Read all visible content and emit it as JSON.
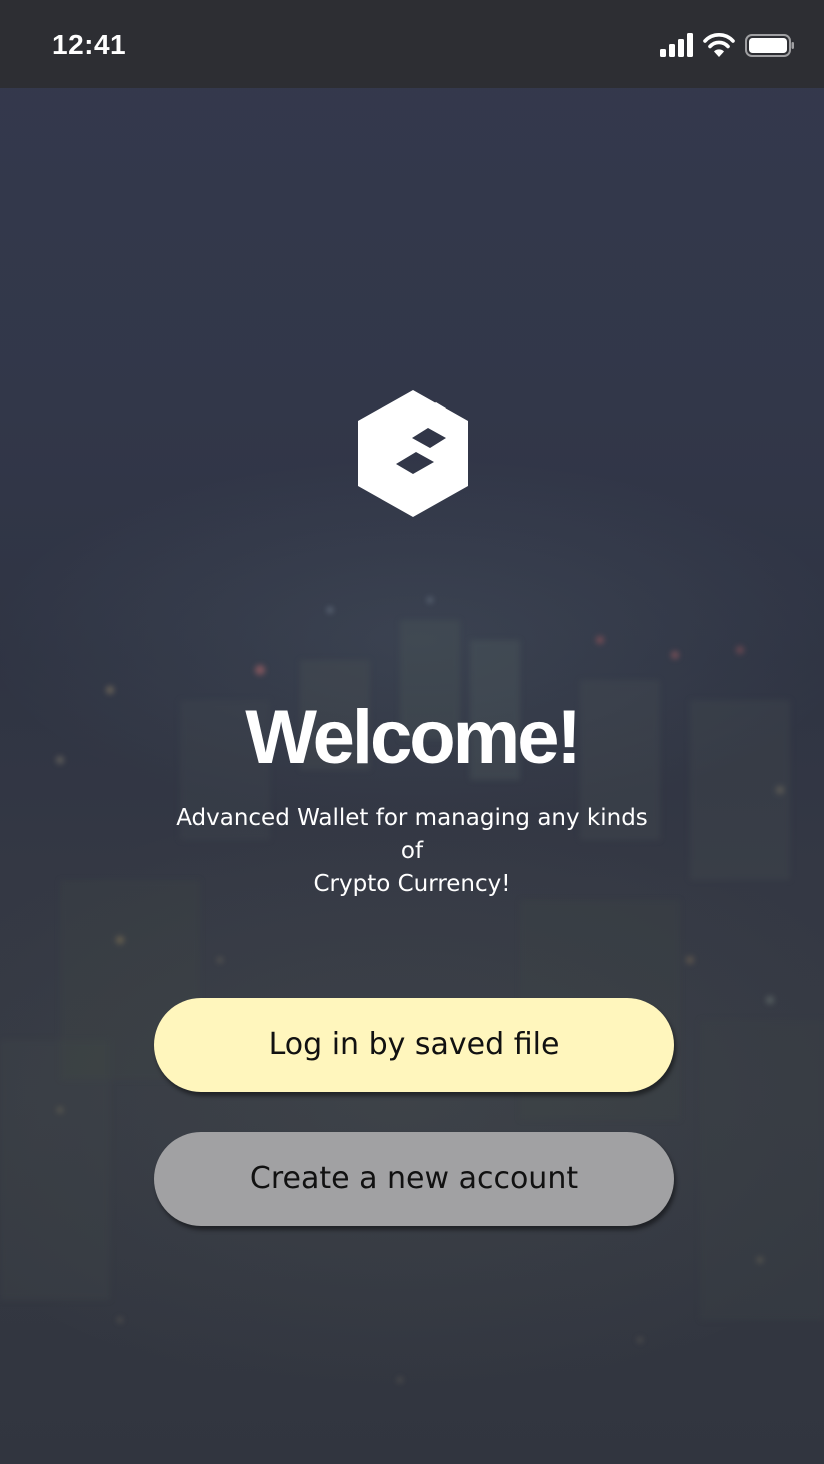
{
  "status_bar": {
    "time": "12:41",
    "icons": [
      "cellular-signal-icon",
      "wifi-icon",
      "battery-icon"
    ]
  },
  "logo": {
    "icon": "wallet-logo-icon"
  },
  "welcome": {
    "title": "Welcome!",
    "subtitle_line1": "Advanced Wallet for managing any kinds of",
    "subtitle_line2": "Crypto Currency!"
  },
  "actions": {
    "login_label": "Log in by saved file",
    "create_label": "Create a new account"
  },
  "colors": {
    "login_button": "#fff6bd",
    "create_button": "#a1a1a3",
    "status_bar": "#2d2e33",
    "background": "#2f3443",
    "text": "#ffffff"
  }
}
